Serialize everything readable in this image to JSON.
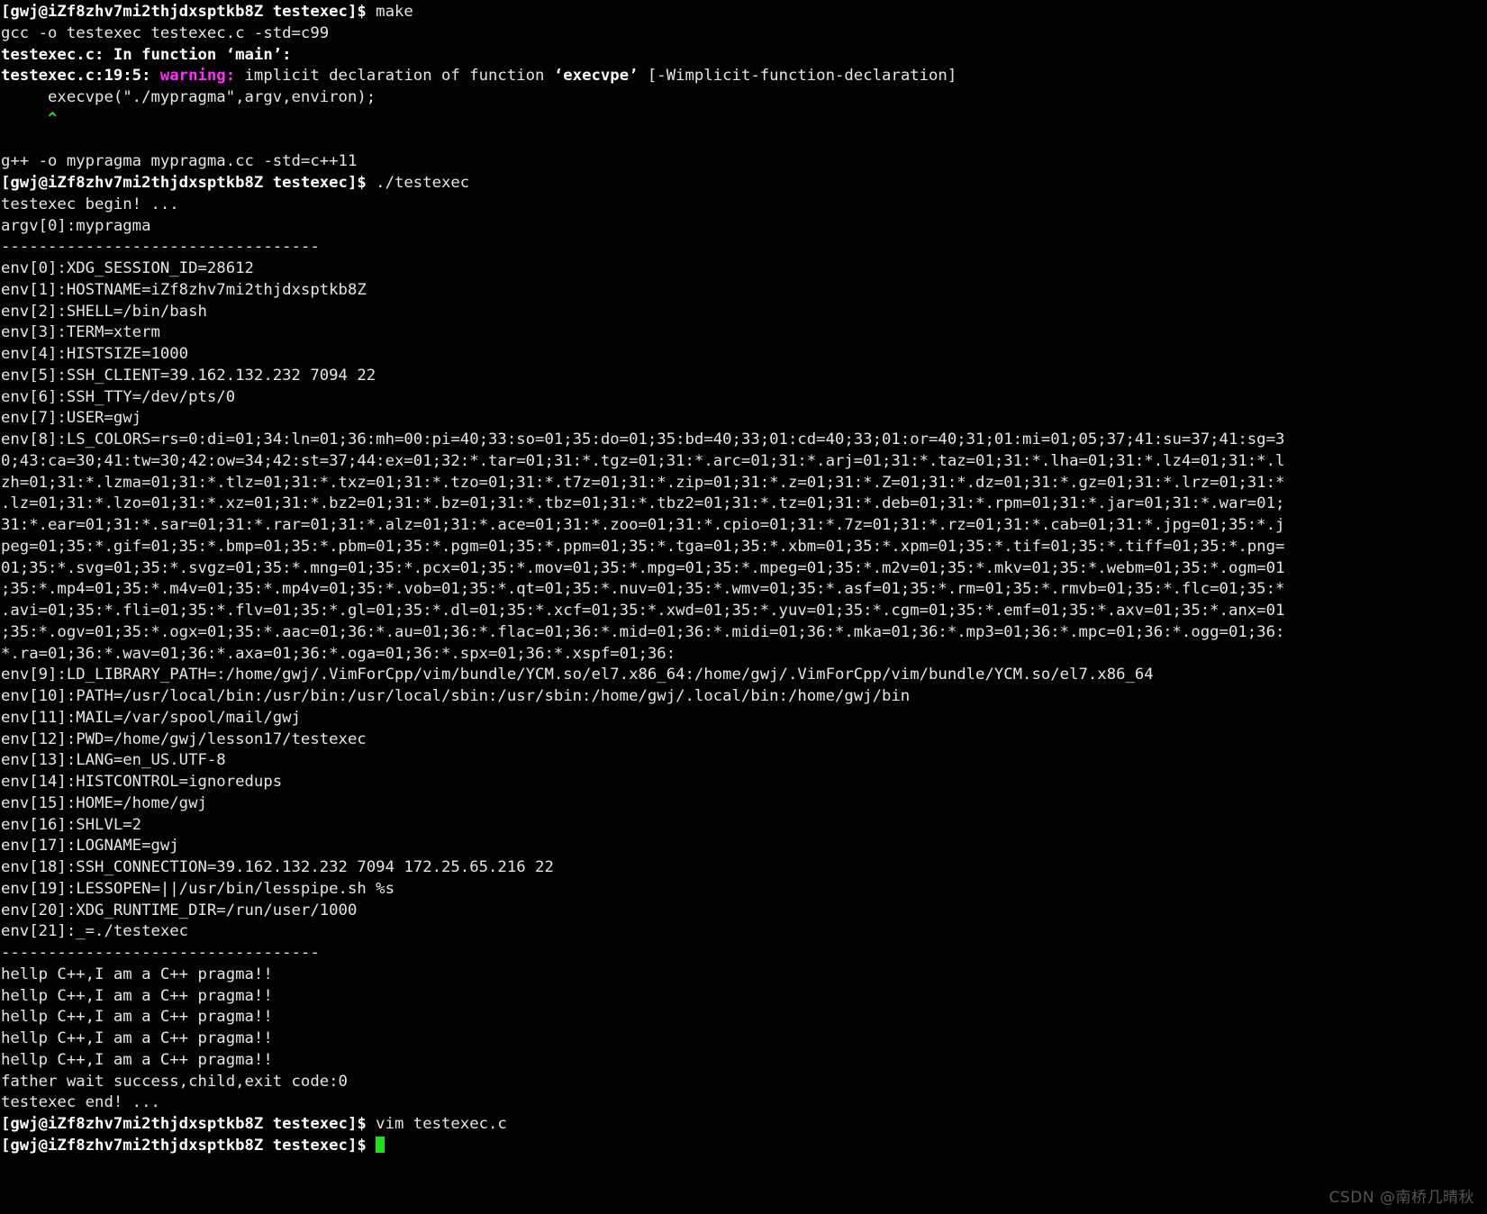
{
  "terminal": {
    "background_color": "#000000",
    "foreground_color": "#d8d8d8",
    "warning_color": "#ff2fff",
    "caret_color": "#19e619",
    "cursor_color": "#19e619",
    "prompt": "[gwj@iZf8zhv7mi2thjdxsptkb8Z testexec]$",
    "lines": [
      {
        "id": "l0",
        "type": "prompt",
        "prompt": "[gwj@iZf8zhv7mi2thjdxsptkb8Z testexec]$",
        "command": " make"
      },
      {
        "id": "l1",
        "type": "plain",
        "text": "gcc -o testexec testexec.c -std=c99"
      },
      {
        "id": "l2",
        "type": "bold",
        "text": "testexec.c: In function ‘main’:"
      },
      {
        "id": "l3",
        "type": "warning",
        "prefix": "testexec.c:19:5: ",
        "keyword": "warning:",
        "suffix_a": " implicit declaration of function ",
        "fnname": "‘execvpe’",
        "suffix_b": " [-Wimplicit-function-declaration]"
      },
      {
        "id": "l4",
        "type": "plain",
        "text": "     execvpe(\"./mypragma\",argv,environ);"
      },
      {
        "id": "l5",
        "type": "caret",
        "text": "     ^"
      },
      {
        "id": "l6",
        "type": "blank",
        "text": ""
      },
      {
        "id": "l7",
        "type": "plain",
        "text": "g++ -o mypragma mypragma.cc -std=c++11"
      },
      {
        "id": "l8",
        "type": "prompt",
        "prompt": "[gwj@iZf8zhv7mi2thjdxsptkb8Z testexec]$",
        "command": " ./testexec"
      },
      {
        "id": "l9",
        "type": "plain",
        "text": "testexec begin! ..."
      },
      {
        "id": "l10",
        "type": "plain",
        "text": "argv[0]:mypragma"
      },
      {
        "id": "l11",
        "type": "plain",
        "text": "----------------------------------"
      },
      {
        "id": "l12",
        "type": "plain",
        "text": "env[0]:XDG_SESSION_ID=28612"
      },
      {
        "id": "l13",
        "type": "plain",
        "text": "env[1]:HOSTNAME=iZf8zhv7mi2thjdxsptkb8Z"
      },
      {
        "id": "l14",
        "type": "plain",
        "text": "env[2]:SHELL=/bin/bash"
      },
      {
        "id": "l15",
        "type": "plain",
        "text": "env[3]:TERM=xterm"
      },
      {
        "id": "l16",
        "type": "plain",
        "text": "env[4]:HISTSIZE=1000"
      },
      {
        "id": "l17",
        "type": "plain",
        "text": "env[5]:SSH_CLIENT=39.162.132.232 7094 22"
      },
      {
        "id": "l18",
        "type": "plain",
        "text": "env[6]:SSH_TTY=/dev/pts/0"
      },
      {
        "id": "l19",
        "type": "plain",
        "text": "env[7]:USER=gwj"
      },
      {
        "id": "l20",
        "type": "plain",
        "text": "env[8]:LS_COLORS=rs=0:di=01;34:ln=01;36:mh=00:pi=40;33:so=01;35:do=01;35:bd=40;33;01:cd=40;33;01:or=40;31;01:mi=01;05;37;41:su=37;41:sg=3"
      },
      {
        "id": "l21",
        "type": "plain",
        "text": "0;43:ca=30;41:tw=30;42:ow=34;42:st=37;44:ex=01;32:*.tar=01;31:*.tgz=01;31:*.arc=01;31:*.arj=01;31:*.taz=01;31:*.lha=01;31:*.lz4=01;31:*.l"
      },
      {
        "id": "l22",
        "type": "plain",
        "text": "zh=01;31:*.lzma=01;31:*.tlz=01;31:*.txz=01;31:*.tzo=01;31:*.t7z=01;31:*.zip=01;31:*.z=01;31:*.Z=01;31:*.dz=01;31:*.gz=01;31:*.lrz=01;31:*"
      },
      {
        "id": "l23",
        "type": "plain",
        "text": ".lz=01;31:*.lzo=01;31:*.xz=01;31:*.bz2=01;31:*.bz=01;31:*.tbz=01;31:*.tbz2=01;31:*.tz=01;31:*.deb=01;31:*.rpm=01;31:*.jar=01;31:*.war=01;"
      },
      {
        "id": "l24",
        "type": "plain",
        "text": "31:*.ear=01;31:*.sar=01;31:*.rar=01;31:*.alz=01;31:*.ace=01;31:*.zoo=01;31:*.cpio=01;31:*.7z=01;31:*.rz=01;31:*.cab=01;31:*.jpg=01;35:*.j"
      },
      {
        "id": "l25",
        "type": "plain",
        "text": "peg=01;35:*.gif=01;35:*.bmp=01;35:*.pbm=01;35:*.pgm=01;35:*.ppm=01;35:*.tga=01;35:*.xbm=01;35:*.xpm=01;35:*.tif=01;35:*.tiff=01;35:*.png="
      },
      {
        "id": "l26",
        "type": "plain",
        "text": "01;35:*.svg=01;35:*.svgz=01;35:*.mng=01;35:*.pcx=01;35:*.mov=01;35:*.mpg=01;35:*.mpeg=01;35:*.m2v=01;35:*.mkv=01;35:*.webm=01;35:*.ogm=01"
      },
      {
        "id": "l27",
        "type": "plain",
        "text": ";35:*.mp4=01;35:*.m4v=01;35:*.mp4v=01;35:*.vob=01;35:*.qt=01;35:*.nuv=01;35:*.wmv=01;35:*.asf=01;35:*.rm=01;35:*.rmvb=01;35:*.flc=01;35:*"
      },
      {
        "id": "l28",
        "type": "plain",
        "text": ".avi=01;35:*.fli=01;35:*.flv=01;35:*.gl=01;35:*.dl=01;35:*.xcf=01;35:*.xwd=01;35:*.yuv=01;35:*.cgm=01;35:*.emf=01;35:*.axv=01;35:*.anx=01"
      },
      {
        "id": "l29",
        "type": "plain",
        "text": ";35:*.ogv=01;35:*.ogx=01;35:*.aac=01;36:*.au=01;36:*.flac=01;36:*.mid=01;36:*.midi=01;36:*.mka=01;36:*.mp3=01;36:*.mpc=01;36:*.ogg=01;36:"
      },
      {
        "id": "l30",
        "type": "plain",
        "text": "*.ra=01;36:*.wav=01;36:*.axa=01;36:*.oga=01;36:*.spx=01;36:*.xspf=01;36:"
      },
      {
        "id": "l31",
        "type": "plain",
        "text": "env[9]:LD_LIBRARY_PATH=:/home/gwj/.VimForCpp/vim/bundle/YCM.so/el7.x86_64:/home/gwj/.VimForCpp/vim/bundle/YCM.so/el7.x86_64"
      },
      {
        "id": "l32",
        "type": "plain",
        "text": "env[10]:PATH=/usr/local/bin:/usr/bin:/usr/local/sbin:/usr/sbin:/home/gwj/.local/bin:/home/gwj/bin"
      },
      {
        "id": "l33",
        "type": "plain",
        "text": "env[11]:MAIL=/var/spool/mail/gwj"
      },
      {
        "id": "l34",
        "type": "plain",
        "text": "env[12]:PWD=/home/gwj/lesson17/testexec"
      },
      {
        "id": "l35",
        "type": "plain",
        "text": "env[13]:LANG=en_US.UTF-8"
      },
      {
        "id": "l36",
        "type": "plain",
        "text": "env[14]:HISTCONTROL=ignoredups"
      },
      {
        "id": "l37",
        "type": "plain",
        "text": "env[15]:HOME=/home/gwj"
      },
      {
        "id": "l38",
        "type": "plain",
        "text": "env[16]:SHLVL=2"
      },
      {
        "id": "l39",
        "type": "plain",
        "text": "env[17]:LOGNAME=gwj"
      },
      {
        "id": "l40",
        "type": "plain",
        "text": "env[18]:SSH_CONNECTION=39.162.132.232 7094 172.25.65.216 22"
      },
      {
        "id": "l41",
        "type": "plain",
        "text": "env[19]:LESSOPEN=||/usr/bin/lesspipe.sh %s"
      },
      {
        "id": "l42",
        "type": "plain",
        "text": "env[20]:XDG_RUNTIME_DIR=/run/user/1000"
      },
      {
        "id": "l43",
        "type": "plain",
        "text": "env[21]:_=./testexec"
      },
      {
        "id": "l44",
        "type": "plain",
        "text": "----------------------------------"
      },
      {
        "id": "l45",
        "type": "plain",
        "text": "hellp C++,I am a C++ pragma!!"
      },
      {
        "id": "l46",
        "type": "plain",
        "text": "hellp C++,I am a C++ pragma!!"
      },
      {
        "id": "l47",
        "type": "plain",
        "text": "hellp C++,I am a C++ pragma!!"
      },
      {
        "id": "l48",
        "type": "plain",
        "text": "hellp C++,I am a C++ pragma!!"
      },
      {
        "id": "l49",
        "type": "plain",
        "text": "hellp C++,I am a C++ pragma!!"
      },
      {
        "id": "l50",
        "type": "plain",
        "text": "father wait success,child,exit code:0"
      },
      {
        "id": "l51",
        "type": "plain",
        "text": "testexec end! ..."
      },
      {
        "id": "l52",
        "type": "prompt",
        "prompt": "[gwj@iZf8zhv7mi2thjdxsptkb8Z testexec]$",
        "command": " vim testexec.c"
      },
      {
        "id": "l53",
        "type": "cursor",
        "prompt": "[gwj@iZf8zhv7mi2thjdxsptkb8Z testexec]$",
        "command": " "
      }
    ]
  },
  "watermark": {
    "text": "CSDN @南桥几晴秋"
  }
}
